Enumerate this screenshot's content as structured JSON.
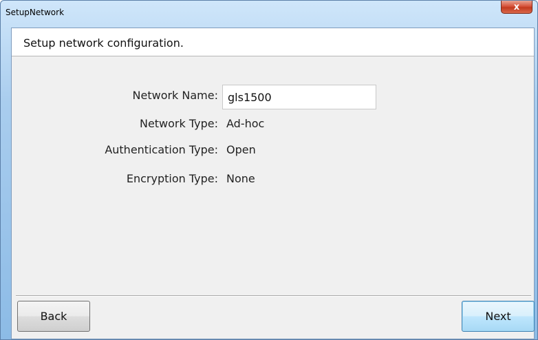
{
  "window": {
    "title": "SetupNetwork",
    "close_glyph": "x"
  },
  "header": {
    "text": "Setup network configuration."
  },
  "form": {
    "network_name_label": "Network Name:",
    "network_name_value": "gls1500",
    "network_type_label": "Network Type:",
    "network_type_value": "Ad-hoc",
    "auth_type_label": "Authentication Type:",
    "auth_type_value": "Open",
    "encryption_type_label": "Encryption Type:",
    "encryption_type_value": "None"
  },
  "buttons": {
    "back_label": "Back",
    "next_label": "Next"
  },
  "colors": {
    "titlebar": "#a9cdee",
    "close_button": "#c33a1f",
    "client_background": "#f0f0f0",
    "default_button_border": "#3c7fb1"
  }
}
